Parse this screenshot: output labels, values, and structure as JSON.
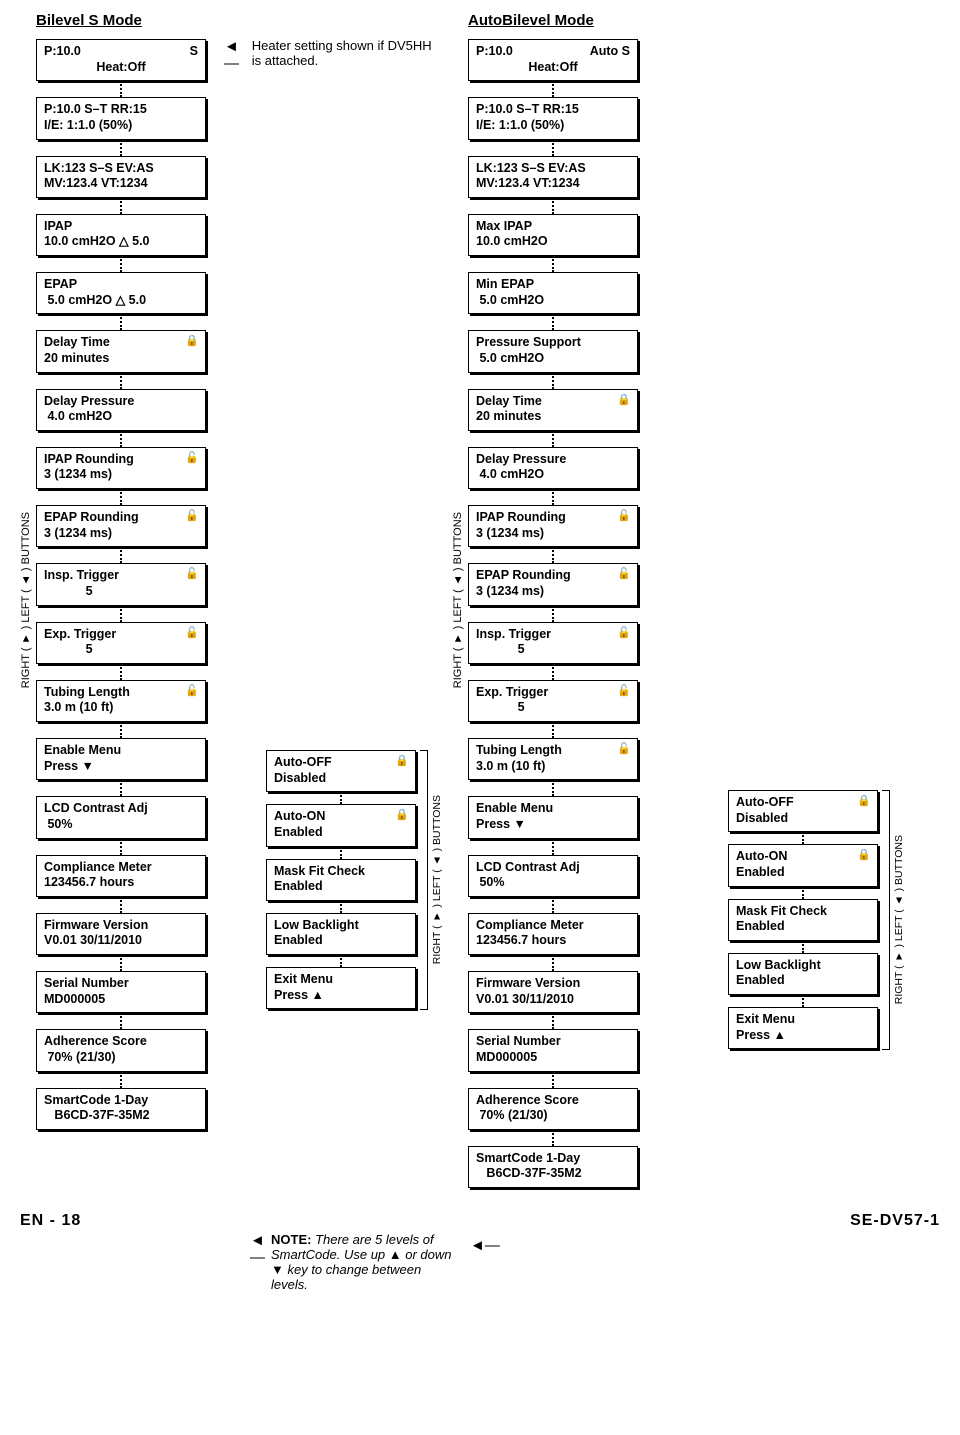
{
  "titles": {
    "bilevel": "Bilevel S Mode",
    "auto": "AutoBilevel Mode"
  },
  "heater_note": "Heater setting shown if DV5HH is attached.",
  "smartcode_note": "There are 5 levels of SmartCode. Use up ▲ or down ▼ key to change between levels.",
  "smartcode_note_prefix": "NOTE:",
  "side_label": "RIGHT ( ▼ ) LEFT ( ▲ ) BUTTONS",
  "bilevel": [
    {
      "l1": "P:10.0",
      "r1": "S",
      "l2": "Heat:Off",
      "center2": true
    },
    {
      "l1": "P:10.0 S–T RR:15",
      "l2": "I/E: 1:1.0 (50%)"
    },
    {
      "l1": "LK:123 S–S EV:AS",
      "l2": "MV:123.4 VT:1234"
    },
    {
      "l1": "IPAP",
      "l2": "10.0 cmH2O △ 5.0"
    },
    {
      "l1": "EPAP",
      "l2": " 5.0 cmH2O △ 5.0"
    },
    {
      "l1": "Delay Time",
      "l2": "20 minutes",
      "lock": "closed"
    },
    {
      "l1": "Delay Pressure",
      "l2": " 4.0 cmH2O"
    },
    {
      "l1": "IPAP Rounding",
      "l2": "3 (1234 ms)",
      "lock": "open"
    },
    {
      "l1": "EPAP Rounding",
      "l2": "3 (1234 ms)",
      "lock": "open"
    },
    {
      "l1": "Insp. Trigger",
      "l2": "            5",
      "lock": "open"
    },
    {
      "l1": "Exp. Trigger",
      "l2": "            5",
      "lock": "open"
    },
    {
      "l1": "Tubing Length",
      "l2": "3.0 m (10 ft)",
      "lock": "open"
    },
    {
      "l1": "Enable Menu",
      "l2": "Press ▼"
    },
    {
      "l1": "LCD Contrast Adj",
      "l2": " 50%"
    },
    {
      "l1": "Compliance Meter",
      "l2": "123456.7 hours"
    },
    {
      "l1": "Firmware Version",
      "l2": "V0.01 30/11/2010"
    },
    {
      "l1": "Serial Number",
      "l2": "MD000005"
    },
    {
      "l1": "Adherence  Score",
      "l2": " 70% (21/30)"
    },
    {
      "l1": "SmartCode         1-Day",
      "l2": "   B6CD-37F-35M2"
    }
  ],
  "auto": [
    {
      "l1": "P:10.0",
      "r1": "Auto S",
      "l2": "Heat:Off",
      "center2": true
    },
    {
      "l1": "P:10.0 S–T RR:15",
      "l2": "I/E: 1:1.0 (50%)"
    },
    {
      "l1": "LK:123 S–S EV:AS",
      "l2": "MV:123.4 VT:1234"
    },
    {
      "l1": "Max IPAP",
      "l2": "10.0 cmH2O"
    },
    {
      "l1": "Min EPAP",
      "l2": " 5.0 cmH2O"
    },
    {
      "l1": "Pressure Support",
      "l2": " 5.0 cmH2O"
    },
    {
      "l1": "Delay Time",
      "l2": "20 minutes",
      "lock": "closed"
    },
    {
      "l1": "Delay Pressure",
      "l2": " 4.0 cmH2O"
    },
    {
      "l1": "IPAP Rounding",
      "l2": "3 (1234 ms)",
      "lock": "open"
    },
    {
      "l1": "EPAP Rounding",
      "l2": "3 (1234 ms)",
      "lock": "open"
    },
    {
      "l1": "Insp. Trigger",
      "l2": "            5",
      "lock": "open"
    },
    {
      "l1": "Exp. Trigger",
      "l2": "            5",
      "lock": "open"
    },
    {
      "l1": "Tubing Length",
      "l2": "3.0 m (10 ft)",
      "lock": "open"
    },
    {
      "l1": "Enable Menu",
      "l2": "Press ▼"
    },
    {
      "l1": "LCD Contrast Adj",
      "l2": " 50%"
    },
    {
      "l1": "Compliance Meter",
      "l2": "123456.7 hours"
    },
    {
      "l1": "Firmware Version",
      "l2": "V0.01 30/11/2010"
    },
    {
      "l1": "Serial Number",
      "l2": "MD000005"
    },
    {
      "l1": "Adherence  Score",
      "l2": " 70% (21/30)"
    },
    {
      "l1": "SmartCode         1-Day",
      "l2": "   B6CD-37F-35M2"
    }
  ],
  "submenu": [
    {
      "l1": "Auto-OFF",
      "l2": "Disabled",
      "lock": "closed"
    },
    {
      "l1": "Auto-ON",
      "l2": "Enabled",
      "lock": "closed"
    },
    {
      "l1": "Mask Fit Check",
      "l2": "Enabled"
    },
    {
      "l1": "Low Backlight",
      "l2": "Enabled"
    },
    {
      "l1": "Exit Menu",
      "l2": "Press ▲"
    }
  ],
  "footer": {
    "left": "EN - 18",
    "right": "SE-DV57-1"
  }
}
